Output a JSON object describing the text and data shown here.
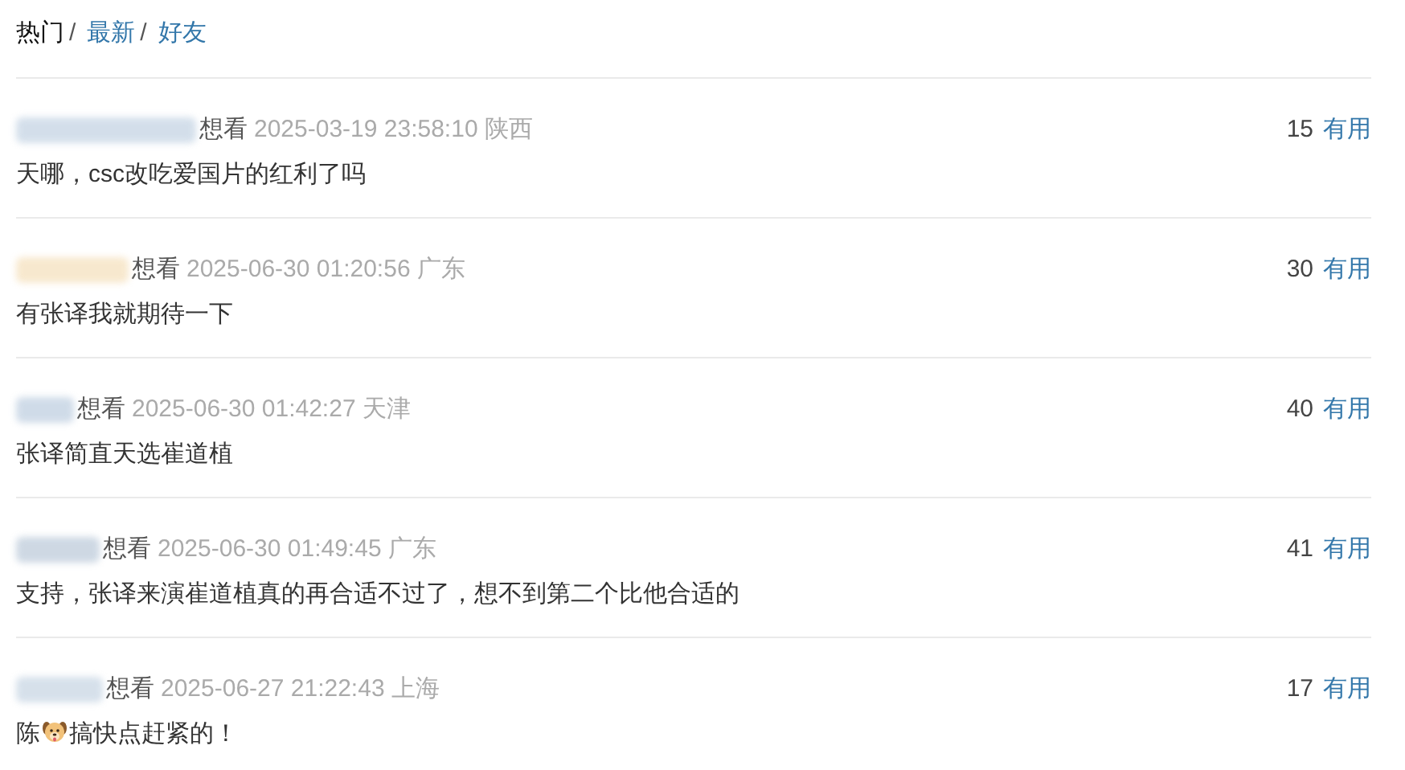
{
  "tabs": [
    {
      "label": "热门",
      "selected": true,
      "separator": "/"
    },
    {
      "label": "最新",
      "selected": false,
      "separator": "/"
    },
    {
      "label": "好友",
      "selected": false
    }
  ],
  "comments": [
    {
      "status": "想看",
      "time": "2025-03-19 23:58:10",
      "location": "陕西",
      "votes": "15",
      "vote_label": "有用",
      "segments": [
        {
          "kind": "text",
          "text": "天哪，csc改吃爱国片的红利了吗"
        }
      ]
    },
    {
      "status": "想看",
      "time": "2025-06-30 01:20:56",
      "location": "广东",
      "votes": "30",
      "vote_label": "有用",
      "segments": [
        {
          "kind": "text",
          "text": "有张译我就期待一下"
        }
      ]
    },
    {
      "status": "想看",
      "time": "2025-06-30 01:42:27",
      "location": "天津",
      "votes": "40",
      "vote_label": "有用",
      "segments": [
        {
          "kind": "text",
          "text": "张译简直天选崔道植"
        }
      ]
    },
    {
      "status": "想看",
      "time": "2025-06-30 01:49:45",
      "location": "广东",
      "votes": "41",
      "vote_label": "有用",
      "segments": [
        {
          "kind": "text",
          "text": "支持，张译来演崔道植真的再合适不过了，想不到第二个比他合适的"
        }
      ]
    },
    {
      "status": "想看",
      "time": "2025-06-27 21:22:43",
      "location": "上海",
      "votes": "17",
      "vote_label": "有用",
      "segments": [
        {
          "kind": "text",
          "text": "陈"
        },
        {
          "kind": "emoji"
        },
        {
          "kind": "text",
          "text": "搞快点赶紧的！"
        }
      ]
    }
  ]
}
